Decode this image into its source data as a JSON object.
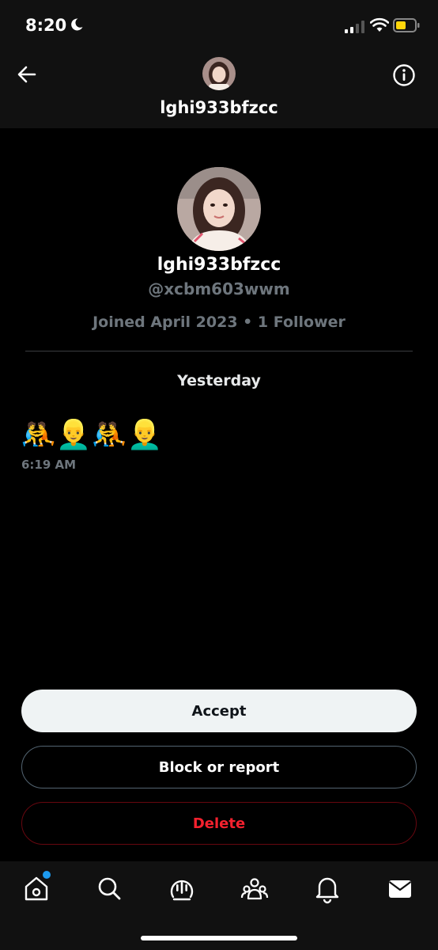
{
  "status_bar": {
    "time": "8:20",
    "icons": [
      "moon-icon",
      "signal-icon",
      "wifi-icon",
      "battery-icon"
    ]
  },
  "header": {
    "title": "lghi933bfzcc",
    "icons": [
      "back-arrow-icon",
      "info-icon"
    ]
  },
  "profile": {
    "display_name": "lghi933bfzcc",
    "handle": "@xcbm603wwm",
    "meta": "Joined April 2023 • 1 Follower"
  },
  "conversation": {
    "date_label": "Yesterday",
    "message": {
      "text": "🤼👱‍♂️🤼👱‍♂️",
      "time": "6:19 AM"
    }
  },
  "actions": {
    "accept_label": "Accept",
    "block_label": "Block or report",
    "delete_label": "Delete"
  },
  "tab_bar": {
    "items": [
      "home-icon",
      "search-icon",
      "spaces-icon",
      "communities-icon",
      "notifications-icon",
      "messages-icon"
    ]
  },
  "colors": {
    "accent": "#1d9bf0",
    "danger": "#f4212e",
    "muted_text": "#6e767d",
    "background": "#000000"
  }
}
